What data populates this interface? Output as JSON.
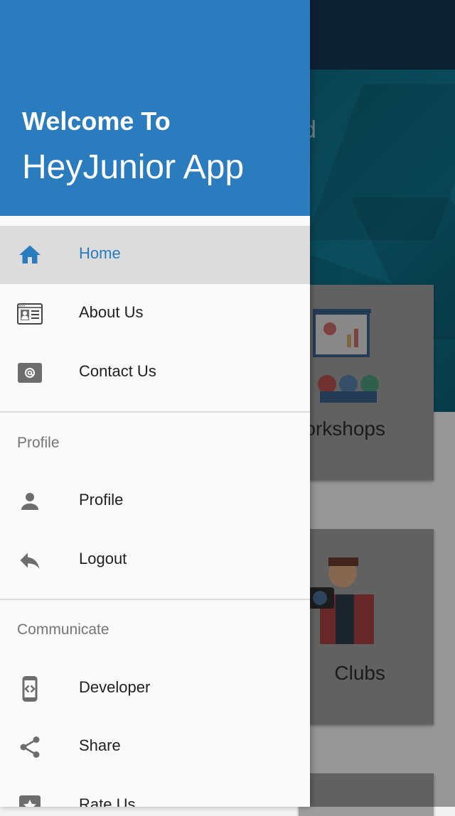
{
  "background": {
    "hero_partial_text": "d",
    "cards": [
      {
        "label": "orkshops"
      },
      {
        "label": "Clubs"
      }
    ]
  },
  "drawer": {
    "header": {
      "welcome": "Welcome To",
      "app_name": "HeyJunior App",
      "color": "#2b7bbf"
    },
    "items": [
      {
        "label": "Home",
        "icon": "home-icon",
        "active": true
      },
      {
        "label": "About Us",
        "icon": "contact-card-icon"
      },
      {
        "label": "Contact Us",
        "icon": "at-mail-icon"
      }
    ],
    "sections": [
      {
        "title": "Profile",
        "items": [
          {
            "label": "Profile",
            "icon": "person-icon"
          },
          {
            "label": "Logout",
            "icon": "reply-arrow-icon"
          }
        ]
      },
      {
        "title": "Communicate",
        "items": [
          {
            "label": "Developer",
            "icon": "developer-phone-icon"
          },
          {
            "label": "Share",
            "icon": "share-icon"
          },
          {
            "label": "Rate Us",
            "icon": "star-rate-icon"
          }
        ]
      }
    ]
  }
}
